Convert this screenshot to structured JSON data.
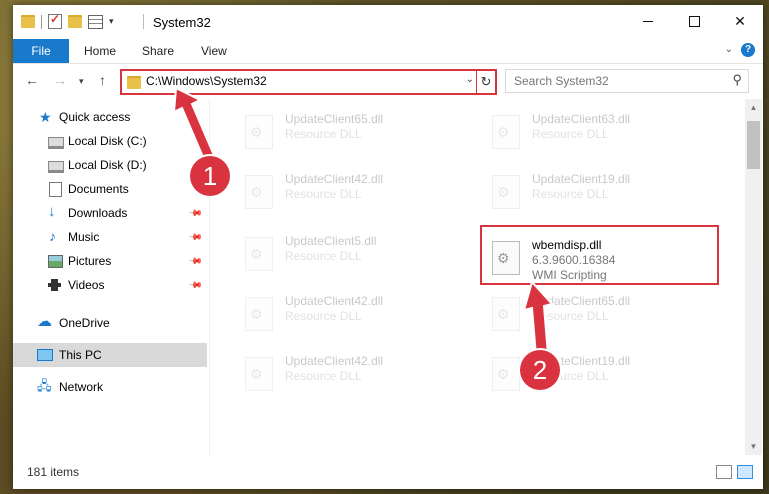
{
  "window": {
    "title": "System32"
  },
  "ribbon": {
    "file": "File",
    "home": "Home",
    "share": "Share",
    "view": "View",
    "help": "?"
  },
  "address": {
    "path": "C:\\Windows\\System32"
  },
  "search": {
    "placeholder": "Search System32"
  },
  "sidebar": {
    "items": [
      {
        "label": "Quick access",
        "icon": "star-icon"
      },
      {
        "label": "Local Disk (C:)",
        "icon": "disk-icon"
      },
      {
        "label": "Local Disk (D:)",
        "icon": "disk-icon"
      },
      {
        "label": "Documents",
        "icon": "document-icon"
      },
      {
        "label": "Downloads",
        "icon": "download-icon",
        "pinned": true
      },
      {
        "label": "Music",
        "icon": "music-icon",
        "pinned": true
      },
      {
        "label": "Pictures",
        "icon": "picture-icon",
        "pinned": true
      },
      {
        "label": "Videos",
        "icon": "video-icon",
        "pinned": true
      },
      {
        "label": "OneDrive",
        "icon": "cloud-icon"
      },
      {
        "label": "This PC",
        "icon": "computer-icon",
        "selected": true
      },
      {
        "label": "Network",
        "icon": "network-icon"
      }
    ]
  },
  "files": {
    "left": [
      {
        "name": "UpdateClient65.dll",
        "type": "Resource DLL"
      },
      {
        "name": "UpdateClient42.dll",
        "type": "Resource DLL"
      },
      {
        "name": "UpdateClient5.dll",
        "type": "Resource DLL"
      },
      {
        "name": "UpdateClient42.dll",
        "type": "Resource DLL"
      },
      {
        "name": "UpdateClient42.dll",
        "type": "Resource DLL"
      }
    ],
    "right": [
      {
        "name": "UpdateClient63.dll",
        "type": "Resource DLL"
      },
      {
        "name": "UpdateClient19.dll",
        "type": "Resource DLL"
      },
      {
        "name": "UpdateClient65.dll",
        "type": "Resource DLL"
      },
      {
        "name": "UpdateClient19.dll",
        "type": "Resource DLL"
      }
    ],
    "highlighted": {
      "name": "wbemdisp.dll",
      "version": "6.3.9600.16384",
      "description": "WMI Scripting"
    }
  },
  "status": {
    "count": "181 items"
  },
  "callouts": {
    "one": "1",
    "two": "2"
  },
  "colors": {
    "accent": "#1979ca",
    "highlight": "#d9333f"
  }
}
